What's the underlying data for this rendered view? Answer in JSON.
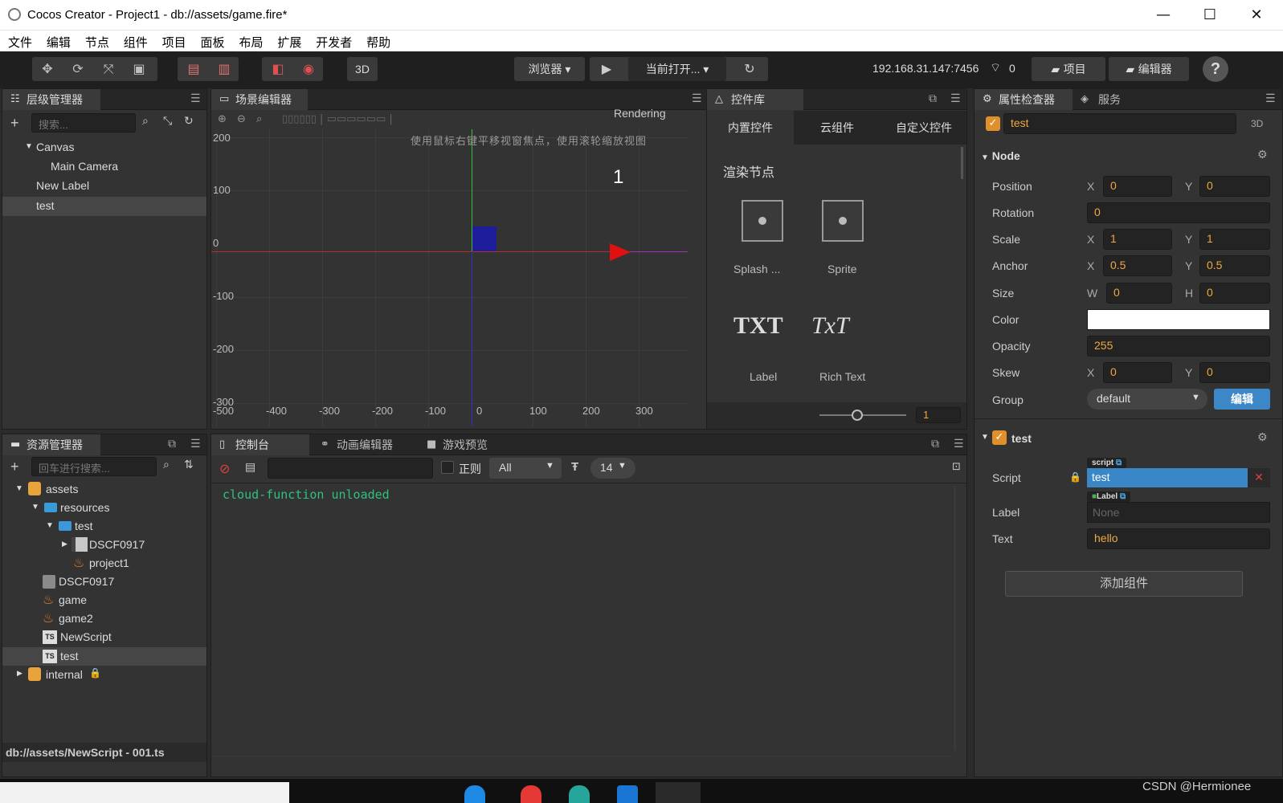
{
  "window": {
    "title": "Cocos Creator - Project1 - db://assets/game.fire*",
    "minimize": "—",
    "maximize": "☐",
    "close": "✕"
  },
  "menu": [
    "文件",
    "编辑",
    "节点",
    "组件",
    "项目",
    "面板",
    "布局",
    "扩展",
    "开发者",
    "帮助"
  ],
  "toolbar": {
    "mode3d": "3D",
    "browser": "浏览器 ▾",
    "play": "▶",
    "current_open": "当前打开... ▾",
    "refresh": "↻",
    "ip": "192.168.31.147:7456",
    "wifi_count": "0",
    "project_btn": "项目",
    "editor_btn": "编辑器",
    "help": "?"
  },
  "hierarchy": {
    "title": "层级管理器",
    "search_placeholder": "搜索...",
    "items": [
      {
        "label": "Canvas",
        "arrow": "▼"
      },
      {
        "label": "Main Camera"
      },
      {
        "label": "New Label"
      },
      {
        "label": "test"
      }
    ]
  },
  "scene": {
    "title": "场景编辑器",
    "rendering": "Rendering",
    "hint": "使用鼠标右键平移视窗焦点，使用滚轮缩放视图",
    "y_labels": [
      "200",
      "100",
      "0",
      "-100",
      "-200",
      "-300"
    ],
    "x_labels": [
      "-500",
      "-400",
      "-300",
      "-200",
      "-100",
      "0",
      "100",
      "200",
      "300"
    ],
    "label_text": "1"
  },
  "widgets": {
    "title": "控件库",
    "tabs": [
      "内置控件",
      "云组件",
      "自定义控件"
    ],
    "section": "渲染节点",
    "items": [
      {
        "name": "Splash ..."
      },
      {
        "name": "Sprite"
      },
      {
        "name": "Label",
        "glyph": "TXT"
      },
      {
        "name": "Rich Text",
        "glyph": "TxT"
      }
    ],
    "zoom_value": "1"
  },
  "assets": {
    "title": "资源管理器",
    "search_placeholder": "回车进行搜索...",
    "items": [
      {
        "label": "assets",
        "arrow": "▼"
      },
      {
        "label": "resources",
        "arrow": "▼"
      },
      {
        "label": "test",
        "arrow": "▼"
      },
      {
        "label": "DSCF0917",
        "arrow": "▶"
      },
      {
        "label": "project1"
      },
      {
        "label": "DSCF0917"
      },
      {
        "label": "game"
      },
      {
        "label": "game2"
      },
      {
        "label": "NewScript"
      },
      {
        "label": "test"
      },
      {
        "label": "internal",
        "arrow": "▶"
      }
    ],
    "status": "db://assets/NewScript - 001.ts"
  },
  "console": {
    "tabs": [
      "控制台",
      "动画编辑器",
      "游戏预览"
    ],
    "regex_label": "正则",
    "level": "All",
    "font_size": "14",
    "log": "cloud-function unloaded"
  },
  "inspector": {
    "tabs": [
      "属性检查器",
      "服务"
    ],
    "node_name": "test",
    "mode": "3D",
    "node_section": "Node",
    "x": "X",
    "y": "Y",
    "w": "W",
    "h": "H",
    "position": {
      "label": "Position",
      "x": "0",
      "y": "0"
    },
    "rotation": {
      "label": "Rotation",
      "value": "0"
    },
    "scale": {
      "label": "Scale",
      "x": "1",
      "y": "1"
    },
    "anchor": {
      "label": "Anchor",
      "x": "0.5",
      "y": "0.5"
    },
    "size": {
      "label": "Size",
      "w": "0",
      "h": "0"
    },
    "color": {
      "label": "Color",
      "value": "#ffffff"
    },
    "opacity": {
      "label": "Opacity",
      "value": "255"
    },
    "skew": {
      "label": "Skew",
      "x": "0",
      "y": "0"
    },
    "group": {
      "label": "Group",
      "value": "default",
      "edit": "编辑"
    },
    "component": {
      "name": "test",
      "script_tag": "script",
      "label_tag": "Label",
      "script_label": "Script",
      "script_value": "test",
      "label_label": "Label",
      "label_value": "None",
      "text_label": "Text",
      "text_value": "hello"
    },
    "add_component": "添加组件"
  },
  "watermark": "CSDN @Hermionee"
}
